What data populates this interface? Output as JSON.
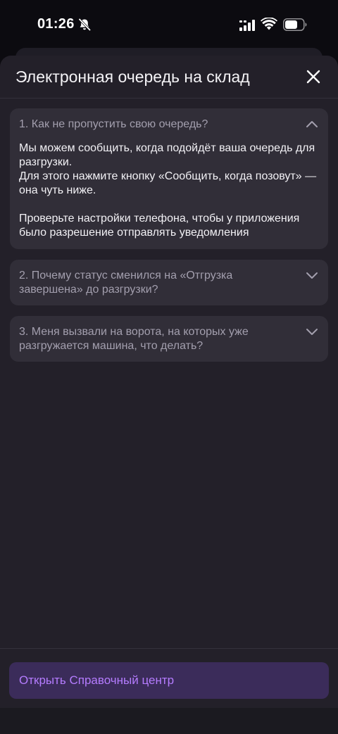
{
  "status_bar": {
    "time": "01:26",
    "icons": [
      "bell-slash-icon",
      "cellular-signal-icon",
      "wifi-icon",
      "battery-icon"
    ]
  },
  "sheet": {
    "title": "Электронная очередь на склад",
    "close_icon": "close-icon"
  },
  "faq": [
    {
      "question": "1. Как не пропустить свою очередь?",
      "expanded": true,
      "answer": {
        "line1": "Мы можем сообщить, когда подойдёт ваша очередь для разгрузки.",
        "line2": "Для этого нажмите кнопку «Сообщить, когда позовут» — она чуть ниже.",
        "line3": "Проверьте настройки телефона, чтобы у приложения было разрешение отправлять уведомления"
      }
    },
    {
      "question": "2. Почему статус сменился на «Отгрузка завершена» до разгрузки?",
      "expanded": false
    },
    {
      "question": "3. Меня вызвали на ворота, на которых уже разгружается машина, что делать?",
      "expanded": false
    }
  ],
  "footer": {
    "help_button_label": "Открыть Справочный центр"
  },
  "colors": {
    "sheet_background": "#232029",
    "card_background": "#312e38",
    "accent": "#b57cff",
    "button_background": "#3b2c5a"
  }
}
